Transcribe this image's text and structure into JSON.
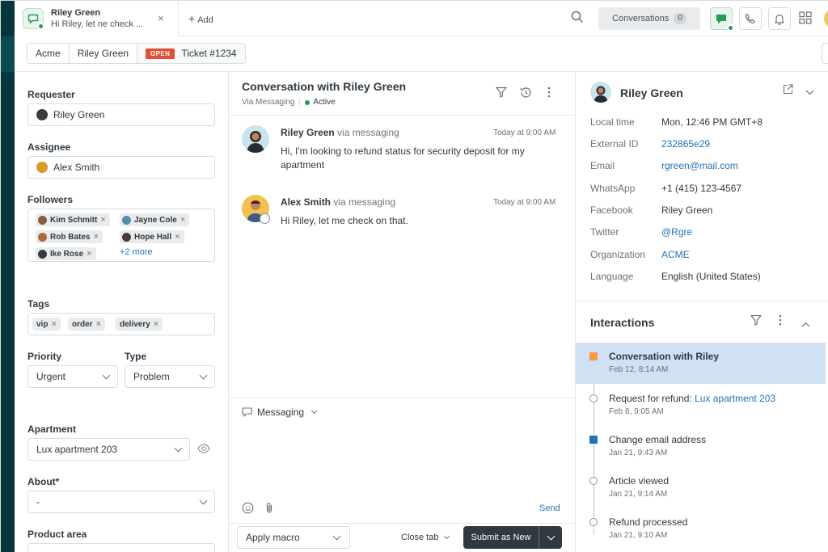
{
  "top_tab": {
    "title": "Riley Green",
    "subtitle": "Hi Riley, let ne check ...",
    "close": "×",
    "add_label": "Add"
  },
  "top_bar": {
    "conversations_label": "Conversations",
    "conversations_count": "0"
  },
  "breadcrumb": {
    "org": "Acme",
    "requester": "Riley Green",
    "status": "OPEN",
    "ticket": "Ticket #1234"
  },
  "properties": {
    "requester_label": "Requester",
    "requester_value": "Riley Green",
    "assignee_label": "Assignee",
    "assignee_value": "Alex Smith",
    "followers_label": "Followers",
    "followers": [
      {
        "name": "Kim Schmitt",
        "color": "#8a5a44"
      },
      {
        "name": "Jayne Cole",
        "color": "#5c8da8"
      },
      {
        "name": "Rob Bates",
        "color": "#b0683c"
      },
      {
        "name": "Hope Hall",
        "color": "#4a3b35"
      },
      {
        "name": "Ike Rose",
        "color": "#3d3a3a"
      }
    ],
    "followers_more": "+2 more",
    "tags_label": "Tags",
    "tags": [
      "vip",
      "order",
      "delivery"
    ],
    "priority_label": "Priority",
    "priority_value": "Urgent",
    "type_label": "Type",
    "type_value": "Problem",
    "apartment_label": "Apartment",
    "apartment_value": "Lux apartment 203",
    "about_label": "About*",
    "about_value": "-",
    "product_area_label": "Product area"
  },
  "conversation": {
    "title": "Conversation with Riley Green",
    "channel": "Via Messaging",
    "status": "Active",
    "messages": [
      {
        "author": "Riley Green",
        "via": "via messaging",
        "time": "Today at 9:00 AM",
        "body": "Hi, I'm looking to refund status for security deposit for my apartment"
      },
      {
        "author": "Alex Smith",
        "via": "via messaging",
        "time": "Today at 9:00 AM",
        "body": "Hi Riley, let me check on that."
      }
    ],
    "composer_channel": "Messaging",
    "send_label": "Send",
    "macro_label": "Apply macro",
    "close_tab_label": "Close tab",
    "submit_label": "Submit as New"
  },
  "context": {
    "name": "Riley Green",
    "fields": [
      {
        "key": "Local time",
        "value": "Mon, 12:46 PM GMT+8",
        "link": false
      },
      {
        "key": "External ID",
        "value": "232865e29",
        "link": true
      },
      {
        "key": "Email",
        "value": "rgreen@mail.com",
        "link": true
      },
      {
        "key": "WhatsApp",
        "value": "+1 (415) 123-4567",
        "link": false
      },
      {
        "key": "Facebook",
        "value": "Riley Green",
        "link": false
      },
      {
        "key": "Twitter",
        "value": "@Rgre",
        "link": true
      },
      {
        "key": "Organization",
        "value": "ACME",
        "link": true
      },
      {
        "key": "Language",
        "value": "English (United States)",
        "link": false
      }
    ],
    "interactions_title": "Interactions",
    "interactions": [
      {
        "title": "Conversation with Riley",
        "link": "",
        "date": "Feb 12, 8:14 AM",
        "marker": "square",
        "color": "#f79a3e",
        "selected": true
      },
      {
        "title": "Request for refund: ",
        "link": "Lux apartment 203",
        "date": "Feb 8, 9:05 AM",
        "marker": "ring",
        "color": "#87929d",
        "selected": false
      },
      {
        "title": "Change email address",
        "link": "",
        "date": "Jan 21, 9:43 AM",
        "marker": "square",
        "color": "#1f73b7",
        "selected": false
      },
      {
        "title": "Article viewed",
        "link": "",
        "date": "Jan 21, 9:14 AM",
        "marker": "ring",
        "color": "#87929d",
        "selected": false
      },
      {
        "title": "Refund processed",
        "link": "",
        "date": "Jan 21, 9:10 AM",
        "marker": "ring",
        "color": "#87929d",
        "selected": false
      }
    ]
  },
  "colors": {
    "nav_dark": "#03363d",
    "link": "#1f73b7",
    "open_badge": "#e34f32",
    "active_green": "#1f9e54",
    "selected_row": "#cfe1f3"
  }
}
